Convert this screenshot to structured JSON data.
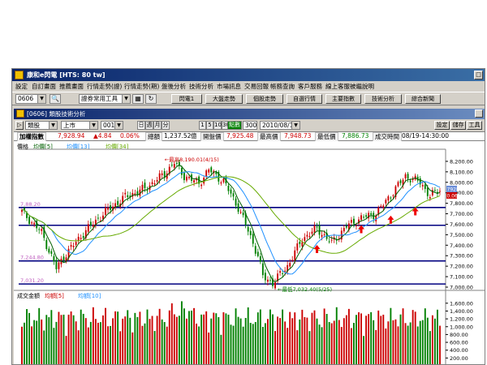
{
  "window": {
    "title": "康和e閃電 [HTS: 80 tw]"
  },
  "menu": [
    "設定",
    "自訂畫面",
    "推薦畫面",
    "行情走勢(證)",
    "行情走勢(期)",
    "盤後分析",
    "技術分析",
    "市場訊息",
    "交易回報",
    "帳務查詢",
    "客戶服務",
    "線上客服",
    "被繼說明"
  ],
  "toolbar": {
    "symbol_value": "0606",
    "tool_select": "證券常用工具",
    "buttons": [
      "閃電1",
      "大盤走勢",
      "個股走勢",
      "自選行情",
      "主要指數",
      "技術分析",
      "綜合新聞"
    ]
  },
  "panel": {
    "title": "[0606] 類股技術分析"
  },
  "controls": {
    "category": "類股",
    "market": "上市",
    "code": "001",
    "periods": [
      "日",
      "週",
      "月",
      "分"
    ],
    "intervals": [
      "1",
      "5",
      "10",
      "30"
    ],
    "points_label": "點數",
    "points_value": "300",
    "date": "2010/08/19",
    "right_buttons": [
      "設定",
      "儲存",
      "工具"
    ]
  },
  "quote": {
    "name": "加權指數",
    "price": "7,928.94",
    "change": "▲4.84",
    "pct": "0.06%",
    "vol_label": "總額",
    "vol": "1,237.52",
    "vol_unit": "億",
    "open_label": "開盤價",
    "open": "7,925.48",
    "high_label": "最高價",
    "high": "7,948.73",
    "low_label": "最低價",
    "low": "7,886.73",
    "time_label": "成交時間",
    "time": "08/19-14:30:00"
  },
  "colors": {
    "up": "#cc0000",
    "down": "#008000",
    "ma5": "#006000",
    "ma13": "#1e90ff",
    "ma34": "#66aa00",
    "sr_line": "#000080"
  },
  "chart_data": [
    {
      "type": "candlestick",
      "legend": [
        "價格",
        "均價[5]",
        "均價[13]",
        "均價[34]"
      ],
      "ylim": [
        7000,
        8300
      ],
      "ticks": [
        "8,200.00",
        "8,100.00",
        "8,000.00",
        "7,900.00",
        "7,800.00",
        "7,700.00",
        "7,600.00",
        "7,500.00",
        "7,400.00",
        "7,300.00",
        "7,200.00",
        "7,100.00",
        "7,000.00"
      ],
      "last_price_tags": [
        "7928.94",
        "0.06%"
      ],
      "annotations": {
        "high": "最高8,190.01(4/15)",
        "low": "最低7,032.40(5/25)"
      },
      "level_labels": [
        "7,88.20",
        "7,244.80",
        "7,031.20"
      ],
      "horizontal_lines": [
        7760,
        7590,
        7250,
        7030
      ]
    },
    {
      "type": "bar",
      "legend": [
        "成交金額",
        "均額[5]",
        "均額[10]"
      ],
      "ylim": [
        0,
        1700
      ],
      "ticks": [
        "1,600.00",
        "1,400.00",
        "1,200.00",
        "1,000.00",
        "800.00",
        "600.00",
        "400.00",
        "200.00"
      ]
    }
  ]
}
